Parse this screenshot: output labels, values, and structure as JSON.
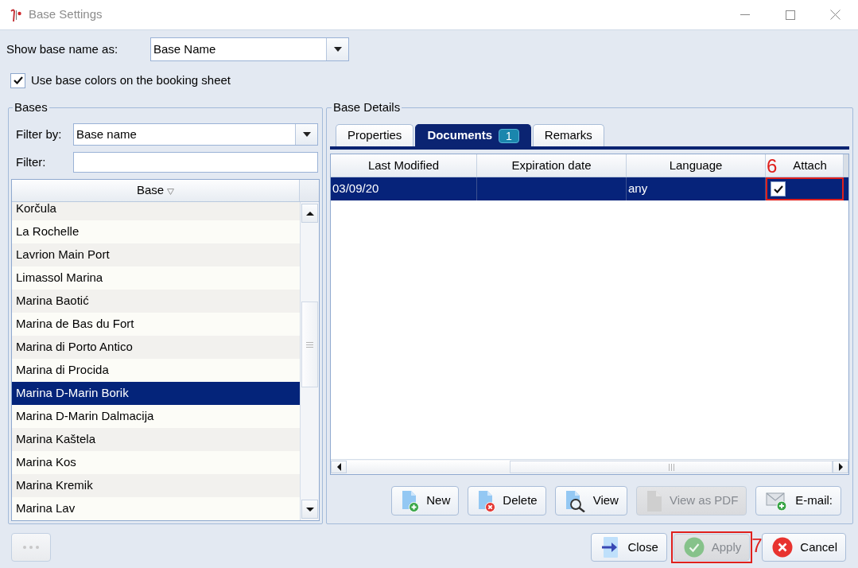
{
  "window": {
    "title": "Base Settings"
  },
  "show_base_name_as": {
    "label": "Show base name as:",
    "value": "Base Name"
  },
  "use_base_colors": {
    "label": "Use base colors on the booking sheet",
    "checked": true
  },
  "bases": {
    "title": "Bases",
    "filter_by": {
      "label": "Filter by:",
      "value": "Base name"
    },
    "filter": {
      "label": "Filter:"
    },
    "column": "Base",
    "rows": [
      {
        "name": "Korčula",
        "selected": false
      },
      {
        "name": "La Rochelle",
        "selected": false
      },
      {
        "name": "Lavrion Main Port",
        "selected": false
      },
      {
        "name": "Limassol Marina",
        "selected": false
      },
      {
        "name": "Marina Baotić",
        "selected": false
      },
      {
        "name": "Marina de Bas du Fort",
        "selected": false
      },
      {
        "name": "Marina di Porto Antico",
        "selected": false
      },
      {
        "name": "Marina di Procida",
        "selected": false
      },
      {
        "name": "Marina D-Marin Borik",
        "selected": true
      },
      {
        "name": "Marina D-Marin Dalmacija",
        "selected": false
      },
      {
        "name": "Marina Kaštela",
        "selected": false
      },
      {
        "name": "Marina Kos",
        "selected": false
      },
      {
        "name": "Marina Kremik",
        "selected": false
      },
      {
        "name": "Marina Lav",
        "selected": false
      }
    ]
  },
  "base_details": {
    "title": "Base Details",
    "tabs": [
      {
        "label": "Properties",
        "selected": false
      },
      {
        "label": "Documents",
        "badge": "1",
        "selected": true
      },
      {
        "label": "Remarks",
        "selected": false
      }
    ],
    "documents": {
      "columns": [
        {
          "label": "Last Modified"
        },
        {
          "label": "Expiration date"
        },
        {
          "label": "Language"
        },
        {
          "label": "Attach",
          "callout": "6"
        }
      ],
      "rows": [
        {
          "last_modified": "03/09/20",
          "language": "any",
          "attach": true,
          "selected": true
        }
      ]
    },
    "buttons": [
      {
        "label": "New",
        "kind": "new",
        "disabled": false
      },
      {
        "label": "Delete",
        "kind": "delete",
        "disabled": false
      },
      {
        "label": "View",
        "kind": "view",
        "disabled": false
      },
      {
        "label": "View as PDF",
        "kind": "pdf",
        "disabled": true
      },
      {
        "label": "E-mail:",
        "kind": "email",
        "disabled": false
      }
    ]
  },
  "footer": {
    "more_button": {
      "disabled": true
    },
    "buttons": [
      {
        "label": "Close",
        "kind": "close",
        "disabled": false
      },
      {
        "label": "Apply",
        "kind": "apply",
        "disabled": true,
        "callout": "7"
      },
      {
        "label": "Cancel",
        "kind": "cancel",
        "disabled": false
      }
    ]
  }
}
